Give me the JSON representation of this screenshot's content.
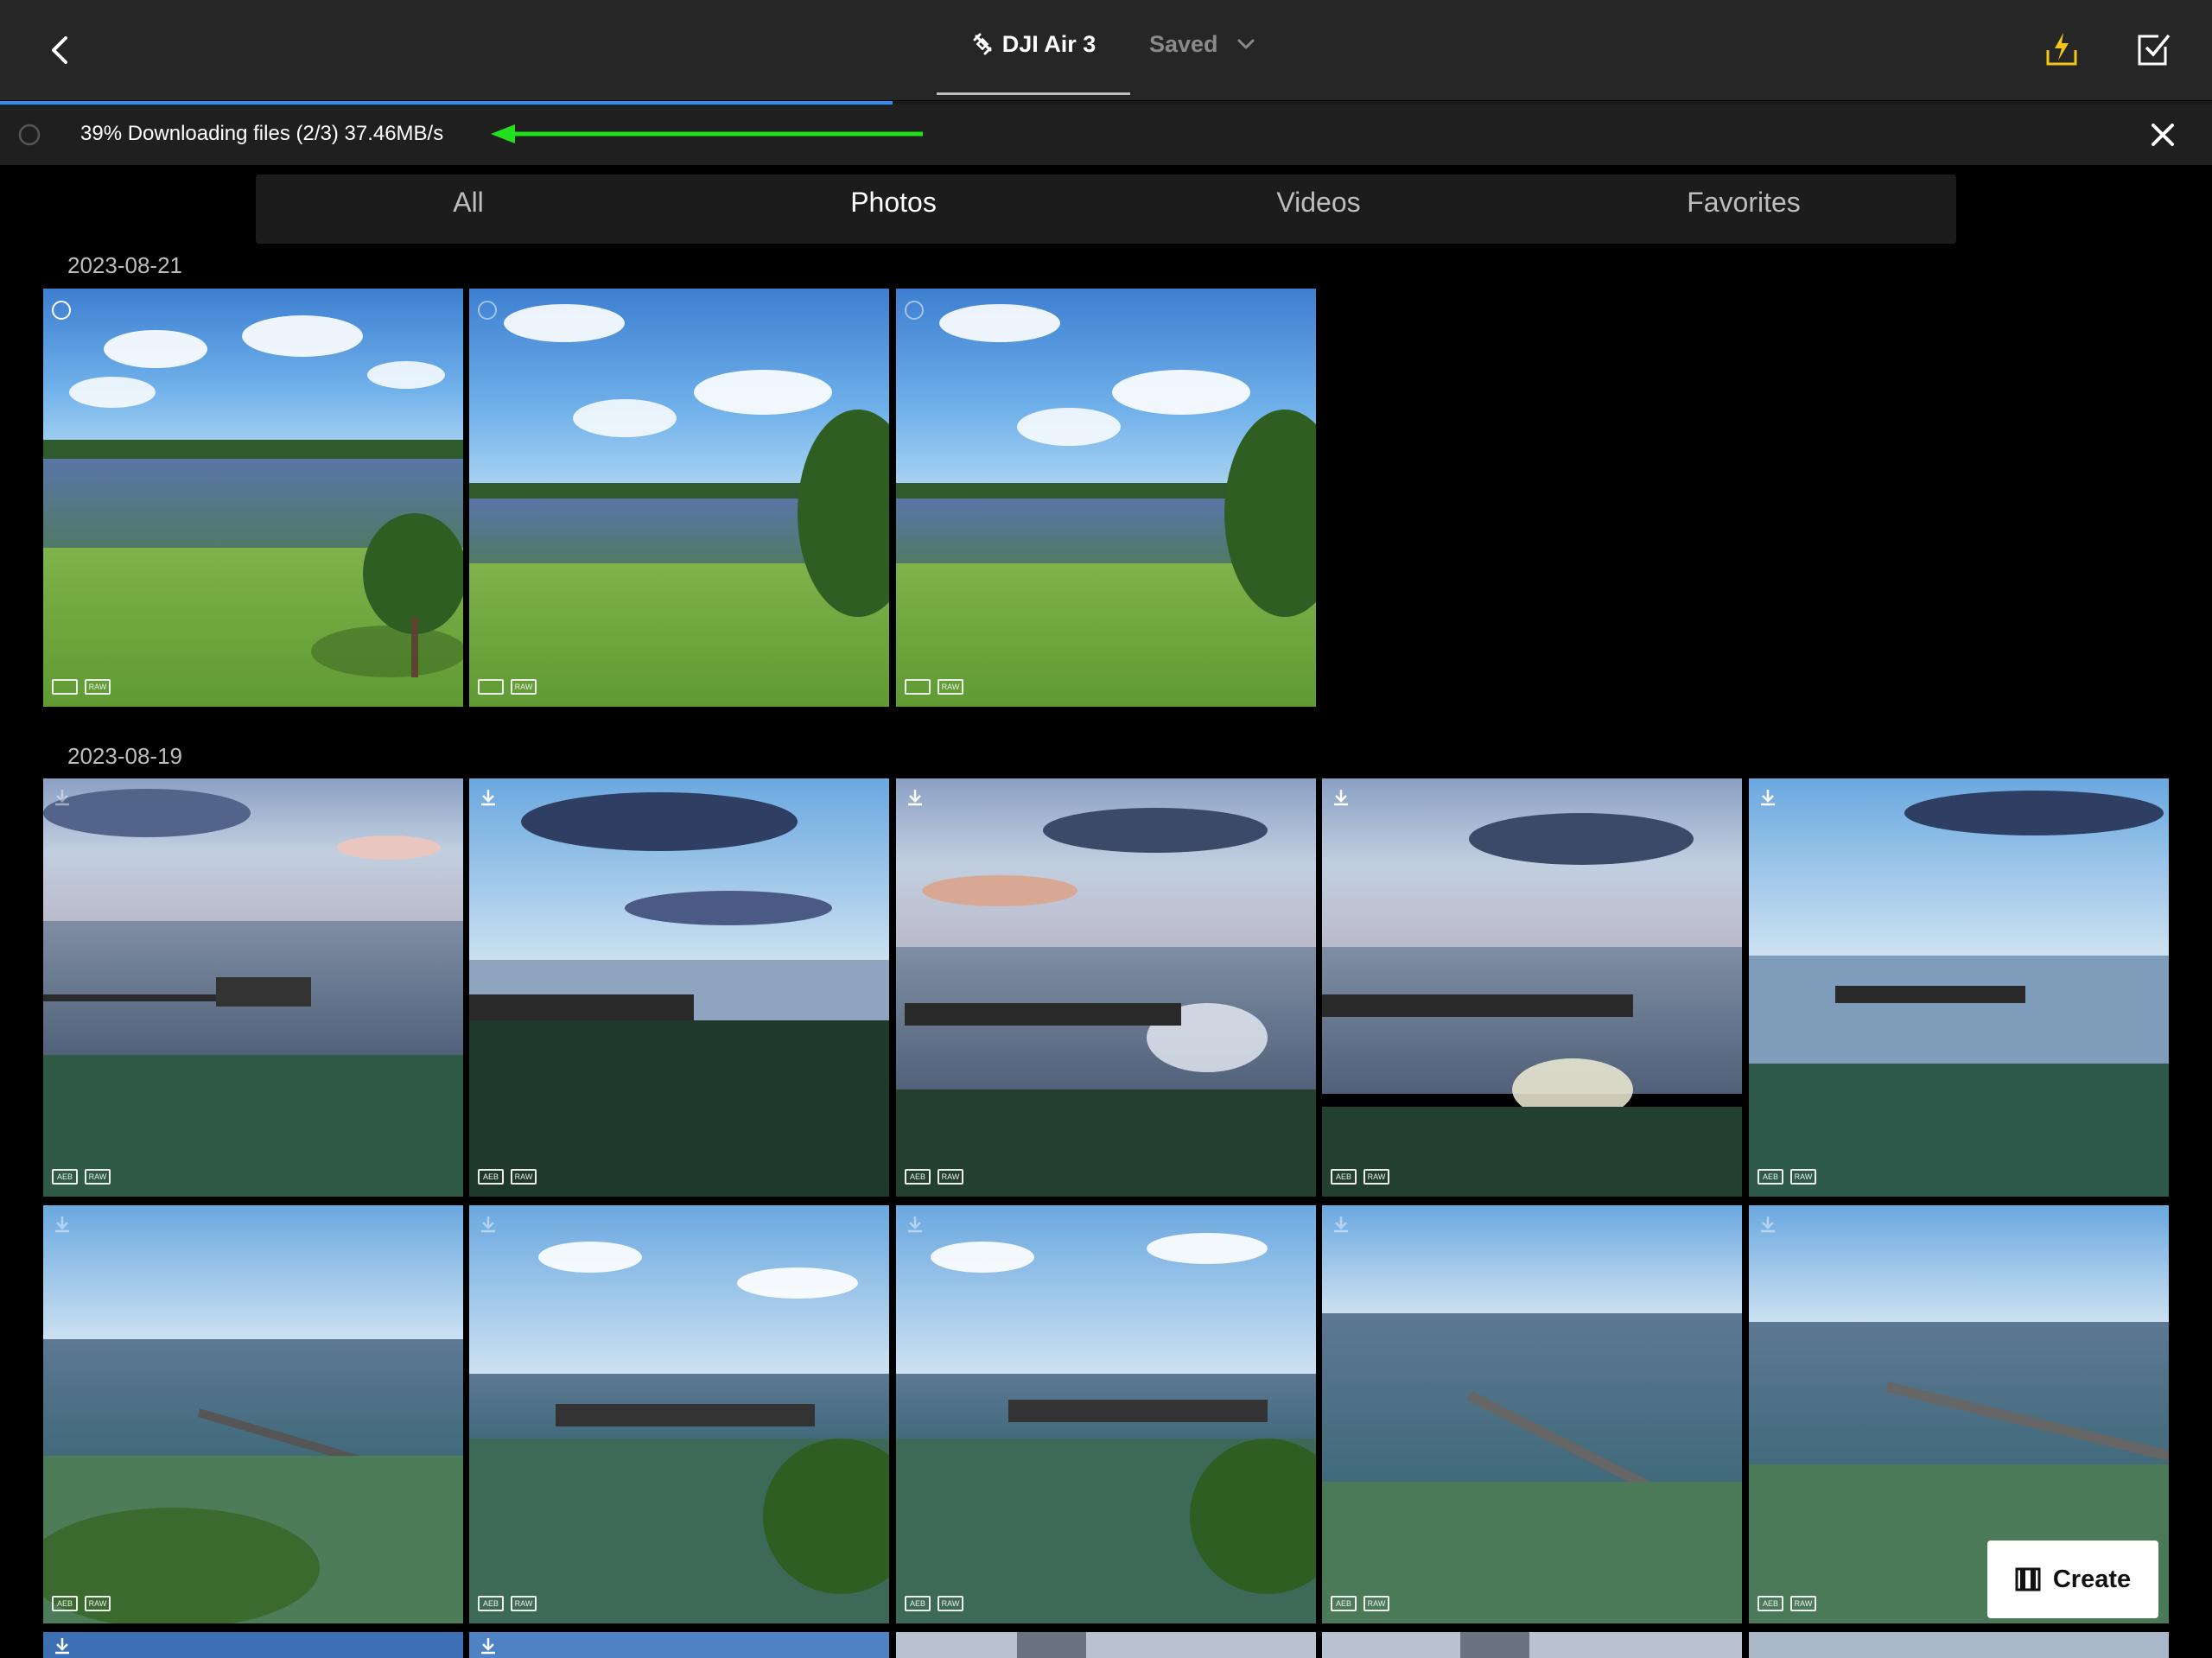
{
  "header": {
    "device_tab": "DJI Air 3",
    "saved_tab": "Saved",
    "icons": {
      "back": "chevron-left-icon",
      "device": "drone-icon",
      "dropdown": "chevron-down-icon",
      "bolt": "lightning-icon",
      "select": "checkbox-icon"
    },
    "accent_color": "#f5c518"
  },
  "download": {
    "status": "39% Downloading files (2/3) 37.46MB/s",
    "progress_fraction": 0.39,
    "progress_color": "#2f8df5",
    "arrow_color": "#22e01b"
  },
  "filters": {
    "tabs": [
      "All",
      "Photos",
      "Videos",
      "Favorites"
    ],
    "active": "Photos"
  },
  "sections": [
    {
      "date": "2023-08-21",
      "count": 3,
      "badges": [
        "img",
        "RAW"
      ]
    },
    {
      "date": "2023-08-19",
      "badges": [
        "AEB",
        "RAW"
      ]
    }
  ],
  "create_button": {
    "label": "Create",
    "icon": "film-icon"
  }
}
